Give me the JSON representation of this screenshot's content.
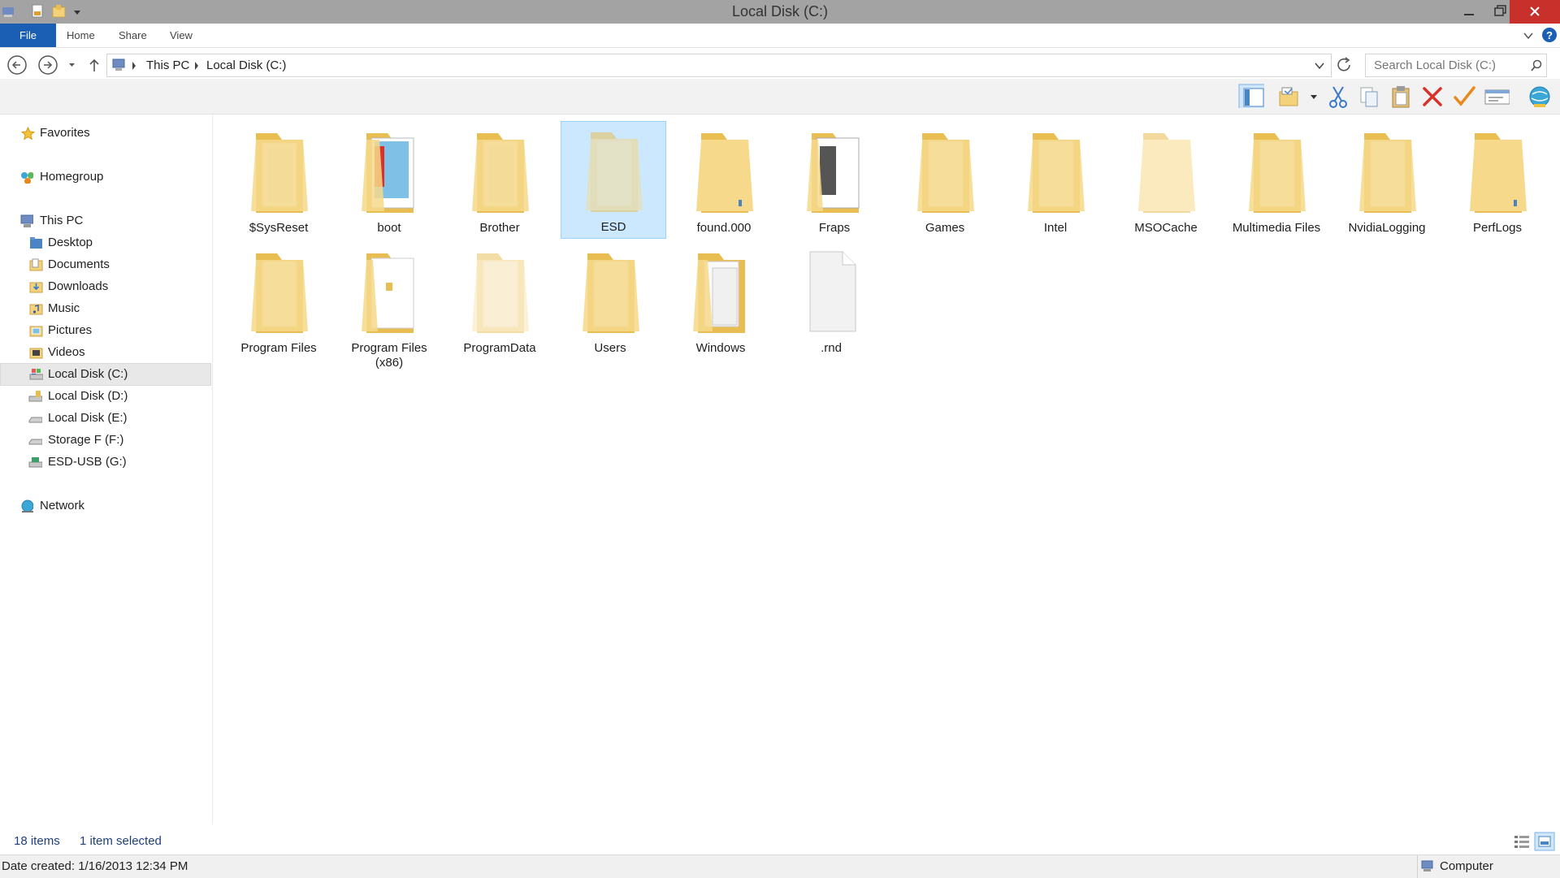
{
  "window": {
    "title": "Local Disk (C:)"
  },
  "ribbon": {
    "file": "File",
    "home": "Home",
    "share": "Share",
    "view": "View"
  },
  "address": {
    "crumbs": [
      "This PC",
      "Local Disk (C:)"
    ],
    "search_placeholder": "Search Local Disk (C:)"
  },
  "nav": {
    "favorites": "Favorites",
    "homegroup": "Homegroup",
    "this_pc": "This PC",
    "pc_items": [
      "Desktop",
      "Documents",
      "Downloads",
      "Music",
      "Pictures",
      "Videos",
      "Local Disk (C:)",
      "Local Disk (D:)",
      "Local Disk (E:)",
      "Storage F (F:)",
      "ESD-USB (G:)"
    ],
    "network": "Network"
  },
  "items": [
    {
      "name": "$SysReset"
    },
    {
      "name": "boot"
    },
    {
      "name": "Brother"
    },
    {
      "name": "ESD"
    },
    {
      "name": "found.000"
    },
    {
      "name": "Fraps"
    },
    {
      "name": "Games"
    },
    {
      "name": "Intel"
    },
    {
      "name": "MSOCache"
    },
    {
      "name": "Multimedia Files"
    },
    {
      "name": "NvidiaLogging"
    },
    {
      "name": "PerfLogs"
    },
    {
      "name": "Program Files"
    },
    {
      "name": "Program Files (x86)"
    },
    {
      "name": "ProgramData"
    },
    {
      "name": "Users"
    },
    {
      "name": "Windows"
    },
    {
      "name": ".rnd"
    }
  ],
  "status": {
    "count": "18 items",
    "selection": "1 item selected",
    "date_created": "Date created: 1/16/2013 12:34 PM",
    "location": "Computer"
  },
  "colors": {
    "accent": "#1a5fb4",
    "selection": "#cce8ff",
    "folder": "#f3d27b",
    "close": "#c7302b"
  }
}
